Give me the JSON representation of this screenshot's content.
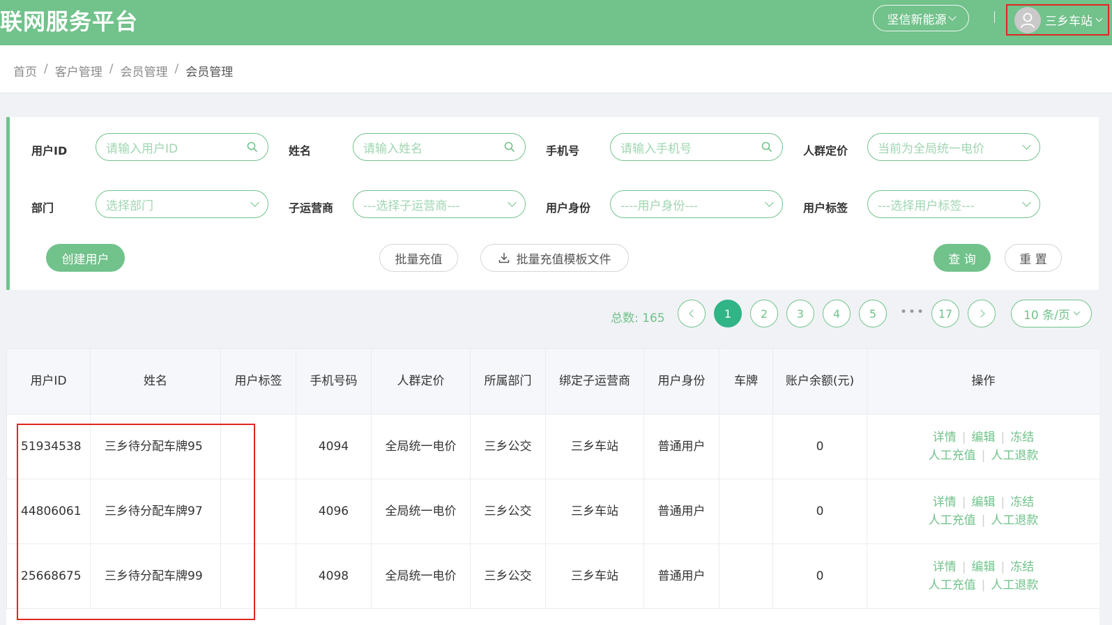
{
  "header": {
    "app_title": "联网服务平台",
    "org_selector": "坚信新能源",
    "user_name": "三乡车站"
  },
  "breadcrumb": [
    "首页",
    "客户管理",
    "会员管理",
    "会员管理"
  ],
  "filters": {
    "user_id": {
      "label": "用户ID",
      "placeholder": "请输入用户ID"
    },
    "name": {
      "label": "姓名",
      "placeholder": "请输入姓名"
    },
    "phone": {
      "label": "手机号",
      "placeholder": "请输入手机号"
    },
    "group_price": {
      "label": "人群定价",
      "value": "当前为全局统一电价"
    },
    "department": {
      "label": "部门",
      "placeholder": "选择部门"
    },
    "sub_operator": {
      "label": "子运营商",
      "placeholder": "---选择子运营商---"
    },
    "identity": {
      "label": "用户身份",
      "placeholder": "----用户身份---"
    },
    "tag": {
      "label": "用户标签",
      "placeholder": "---选择用户标签---"
    }
  },
  "actions": {
    "create_user": "创建用户",
    "batch_recharge": "批量充值",
    "batch_template": "批量充值模板文件",
    "query": "查 询",
    "reset": "重 置"
  },
  "pagination": {
    "total_label": "总数:",
    "total": "165",
    "pages": [
      "1",
      "2",
      "3",
      "4",
      "5"
    ],
    "last_page": "17",
    "ellipsis": "•••",
    "current": "1",
    "page_size": "10 条/页"
  },
  "table": {
    "headers": [
      "用户ID",
      "姓名",
      "用户标签",
      "手机号码",
      "人群定价",
      "所属部门",
      "绑定子运营商",
      "用户身份",
      "车牌",
      "账户余额(元)",
      "操作"
    ],
    "rows": [
      {
        "id": "51934538",
        "name": "三乡待分配车牌95",
        "tag": "",
        "phone": "4094",
        "price": "全局统一电价",
        "dept": "三乡公交",
        "operator": "三乡车站",
        "identity": "普通用户",
        "plate": "",
        "balance": "0"
      },
      {
        "id": "44806061",
        "name": "三乡待分配车牌97",
        "tag": "",
        "phone": "4096",
        "price": "全局统一电价",
        "dept": "三乡公交",
        "operator": "三乡车站",
        "identity": "普通用户",
        "plate": "",
        "balance": "0"
      },
      {
        "id": "25668675",
        "name": "三乡待分配车牌99",
        "tag": "",
        "phone": "4098",
        "price": "全局统一电价",
        "dept": "三乡公交",
        "operator": "三乡车站",
        "identity": "普通用户",
        "plate": "",
        "balance": "0"
      }
    ],
    "row_actions": {
      "detail": "详情",
      "edit": "编辑",
      "freeze": "冻结",
      "manual_recharge": "人工充值",
      "manual_refund": "人工退款"
    }
  },
  "colors": {
    "brand": "#71c28b",
    "highlight": "#e0261f",
    "active_page": "#31b486"
  },
  "icons": [
    "avatar-icon",
    "search-icon",
    "chevron-down-icon",
    "download-icon",
    "chevron-left-icon",
    "chevron-right-icon"
  ]
}
